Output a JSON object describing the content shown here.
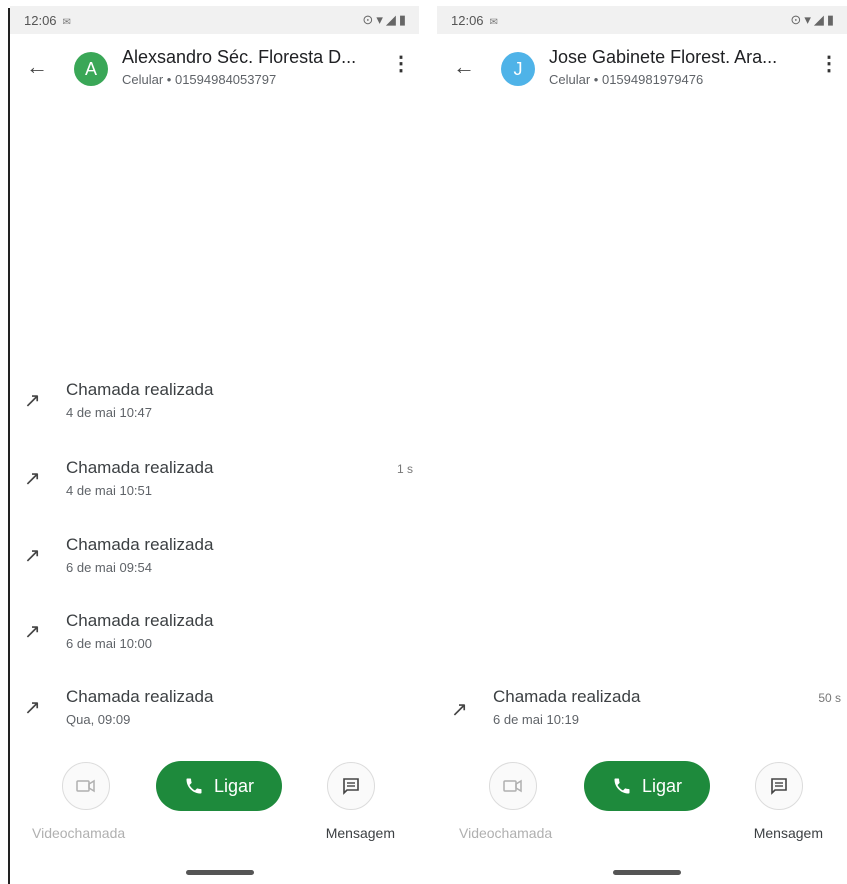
{
  "status_bar": {
    "time": "12:06",
    "notification_icon": "mail-icon",
    "system_icons": [
      "sync-icon",
      "wifi-icon",
      "signal-icon",
      "battery-icon"
    ]
  },
  "screens": [
    {
      "contact_name": "Alexsandro Séc. Floresta D...",
      "contact_initial": "A",
      "avatar_color": "#3aa757",
      "contact_number": "Celular • 01594984053797",
      "calls": [
        {
          "title": "Chamada realizada",
          "date": "4 de mai 10:47",
          "duration": ""
        },
        {
          "title": "Chamada realizada",
          "date": "4 de mai 10:51",
          "duration": "1 s"
        },
        {
          "title": "Chamada realizada",
          "date": "6 de mai 09:54",
          "duration": ""
        },
        {
          "title": "Chamada realizada",
          "date": "6 de mai 10:00",
          "duration": ""
        },
        {
          "title": "Chamada realizada",
          "date": "Qua, 09:09",
          "duration": ""
        }
      ]
    },
    {
      "contact_name": "Jose Gabinete Florest. Ara...",
      "contact_initial": "J",
      "avatar_color": "#4fb3e8",
      "contact_number": "Celular • 01594981979476",
      "calls": [
        {
          "title": "Chamada realizada",
          "date": "6 de mai 10:19",
          "duration": "50 s"
        }
      ]
    }
  ],
  "actions": {
    "video_label": "Videochamada",
    "call_label": "Ligar",
    "message_label": "Mensagem"
  },
  "colors": {
    "call_button": "#1e8a3c",
    "disabled_text": "#b0b0b0"
  }
}
